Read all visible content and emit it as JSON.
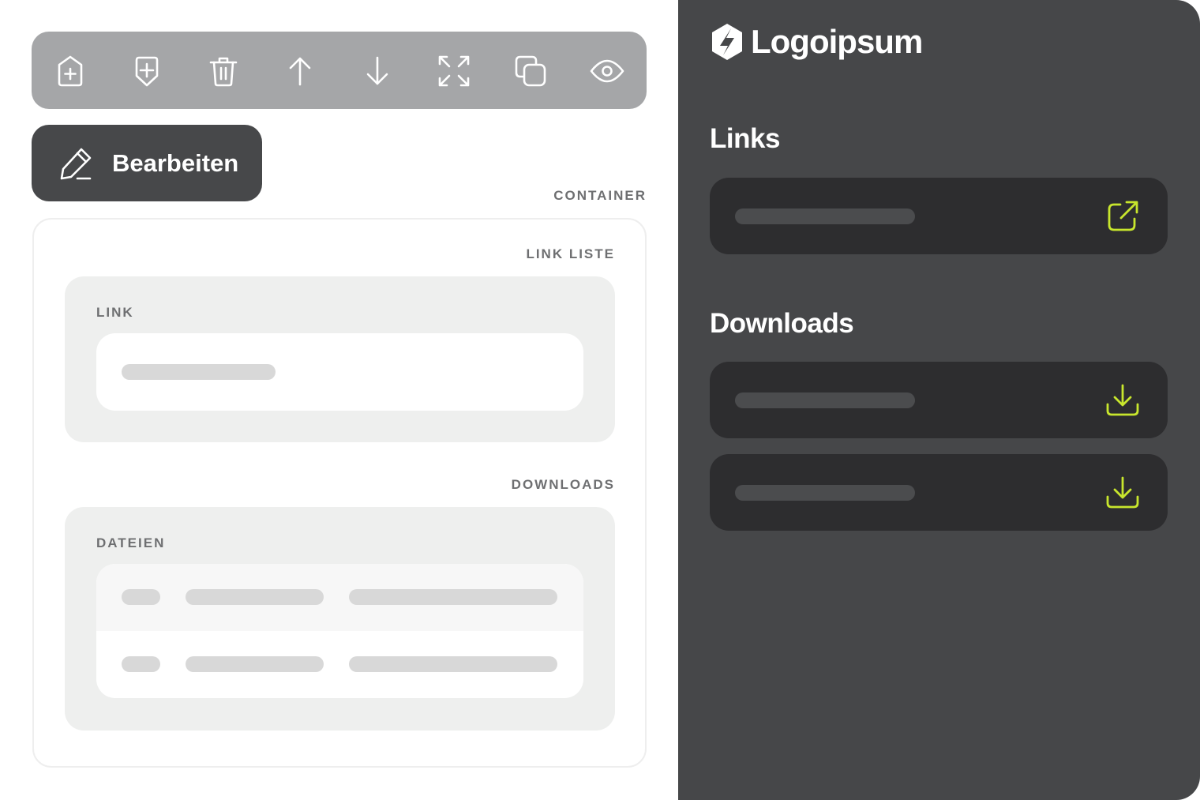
{
  "toolbar": {
    "icons": [
      "add-item-icon",
      "add-component-icon",
      "trash-icon",
      "arrow-up-icon",
      "arrow-down-icon",
      "expand-icon",
      "copy-icon",
      "eye-icon"
    ]
  },
  "edit_button": {
    "label": "Bearbeiten",
    "icon": "pencil-icon"
  },
  "editor": {
    "container_label": "CONTAINER",
    "link_list_label": "LINK LISTE",
    "link_label": "LINK",
    "downloads_label": "DOWNLOADS",
    "files_label": "DATEIEN"
  },
  "preview": {
    "logo_text": "Logoipsum",
    "links_title": "Links",
    "downloads_title": "Downloads",
    "link_icon": "external-link-icon",
    "download_icon": "download-icon"
  },
  "colors": {
    "accent": "#c8e62d",
    "dark_panel": "#464749",
    "card": "#2d2d2f",
    "toolbar": "#a5a6a8"
  }
}
